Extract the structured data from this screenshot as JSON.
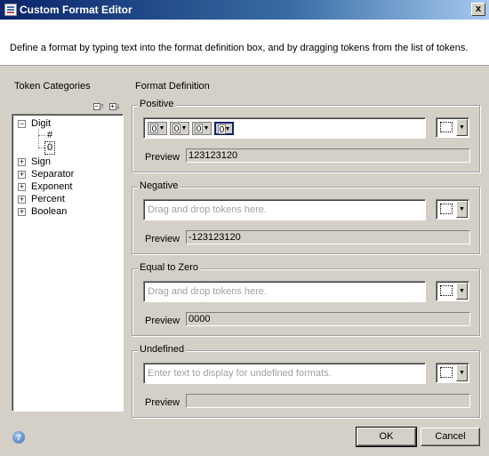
{
  "window": {
    "title": "Custom Format Editor",
    "close_label": "x"
  },
  "header": {
    "description": "Define a format by typing text into the format definition box, and by dragging tokens from the list of tokens."
  },
  "token_categories": {
    "label": "Token Categories",
    "tree": {
      "digit": {
        "label": "Digit",
        "children": [
          "#",
          "0"
        ]
      },
      "sign": "Sign",
      "separator": "Separator",
      "exponent": "Exponent",
      "percent": "Percent",
      "boolean": "Boolean"
    }
  },
  "format_definition": {
    "label": "Format Definition",
    "positive": {
      "title": "Positive",
      "tokens": [
        "0",
        "0",
        "0",
        "0"
      ],
      "preview_label": "Preview",
      "preview_value": "123123120"
    },
    "negative": {
      "title": "Negative",
      "placeholder": "Drag and drop tokens here.",
      "preview_label": "Preview",
      "preview_value": "-123123120"
    },
    "zero": {
      "title": "Equal to Zero",
      "placeholder": "Drag and drop tokens here.",
      "preview_label": "Preview",
      "preview_value": "0000"
    },
    "undefined": {
      "title": "Undefined",
      "placeholder": "Enter text to display for undefined formats.",
      "preview_label": "Preview",
      "preview_value": ""
    }
  },
  "buttons": {
    "ok": "OK",
    "cancel": "Cancel",
    "help": "?"
  }
}
